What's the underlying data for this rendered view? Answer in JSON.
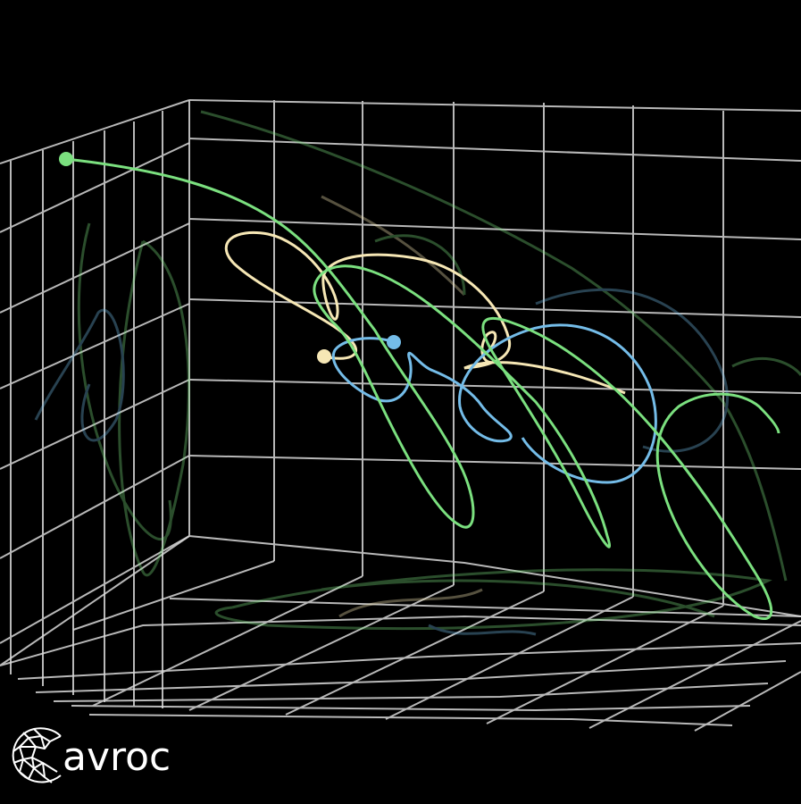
{
  "scene": {
    "background": "#000000",
    "grid_color": "#d9d9d9",
    "trajectories": [
      {
        "name_color": "green",
        "color": "#7be07f"
      },
      {
        "name_color": "cream",
        "color": "#f6e7b5"
      },
      {
        "name_color": "blue",
        "color": "#74bce8"
      }
    ],
    "shadow_opacity": 0.35
  },
  "logo": {
    "icon": "cavroc-geodesic-c-icon",
    "wordmark": "avroc",
    "color": "#ffffff"
  }
}
